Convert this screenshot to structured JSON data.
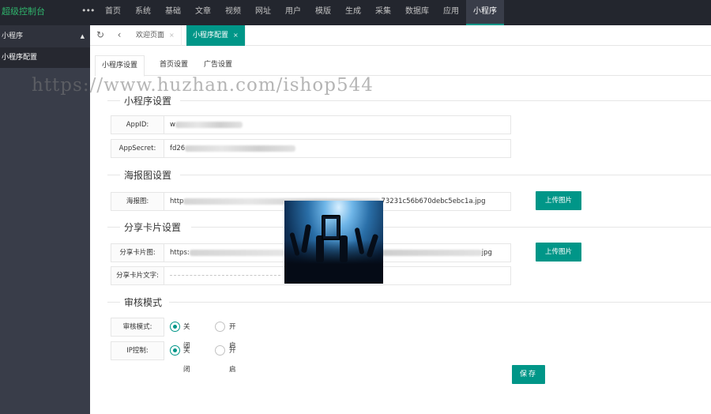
{
  "app": {
    "logo": "超级控制台",
    "more": "•••"
  },
  "nav": [
    "首页",
    "系统",
    "基础",
    "文章",
    "视频",
    "网址",
    "用户",
    "模版",
    "生成",
    "采集",
    "数据库",
    "应用",
    "小程序"
  ],
  "nav_active": "小程序",
  "sidebar": {
    "group": "小程序",
    "item": "小程序配置"
  },
  "tabbar": {
    "tabs": [
      {
        "label": "欢迎页面",
        "close": "×"
      },
      {
        "label": "小程序配置",
        "close": "×"
      }
    ]
  },
  "subtabs": [
    "小程序设置",
    "首页设置",
    "广告设置"
  ],
  "watermark": "https://www.huzhan.com/ishop544",
  "sections": {
    "mini": "小程序设置",
    "poster": "海报图设置",
    "share": "分享卡片设置",
    "audit": "审核模式"
  },
  "fields": {
    "appid": {
      "label": "AppID:",
      "value": "w"
    },
    "appsecret": {
      "label": "AppSecret:",
      "value": "fd26"
    },
    "poster": {
      "label": "海报图:",
      "value_start": "http",
      "value_end": "73231c56b670debc5ebc1a.jpg"
    },
    "share_img": {
      "label": "分享卡片图:",
      "value_start": "https:",
      "value_end": "jpg"
    },
    "share_text": {
      "label": "分享卡片文字:"
    }
  },
  "buttons": {
    "upload": "上传图片",
    "save": "保存"
  },
  "radios": {
    "audit_mode": {
      "label": "审核模式:",
      "off": "关闭",
      "on": "开启",
      "selected": "off"
    },
    "ip_control": {
      "label": "IP控制:",
      "off": "关闭",
      "on": "开启",
      "selected": "off"
    }
  },
  "colors": {
    "accent": "#009688",
    "topbar": "#23262e",
    "sidebar": "#393d49",
    "logo": "#2fb36c"
  }
}
